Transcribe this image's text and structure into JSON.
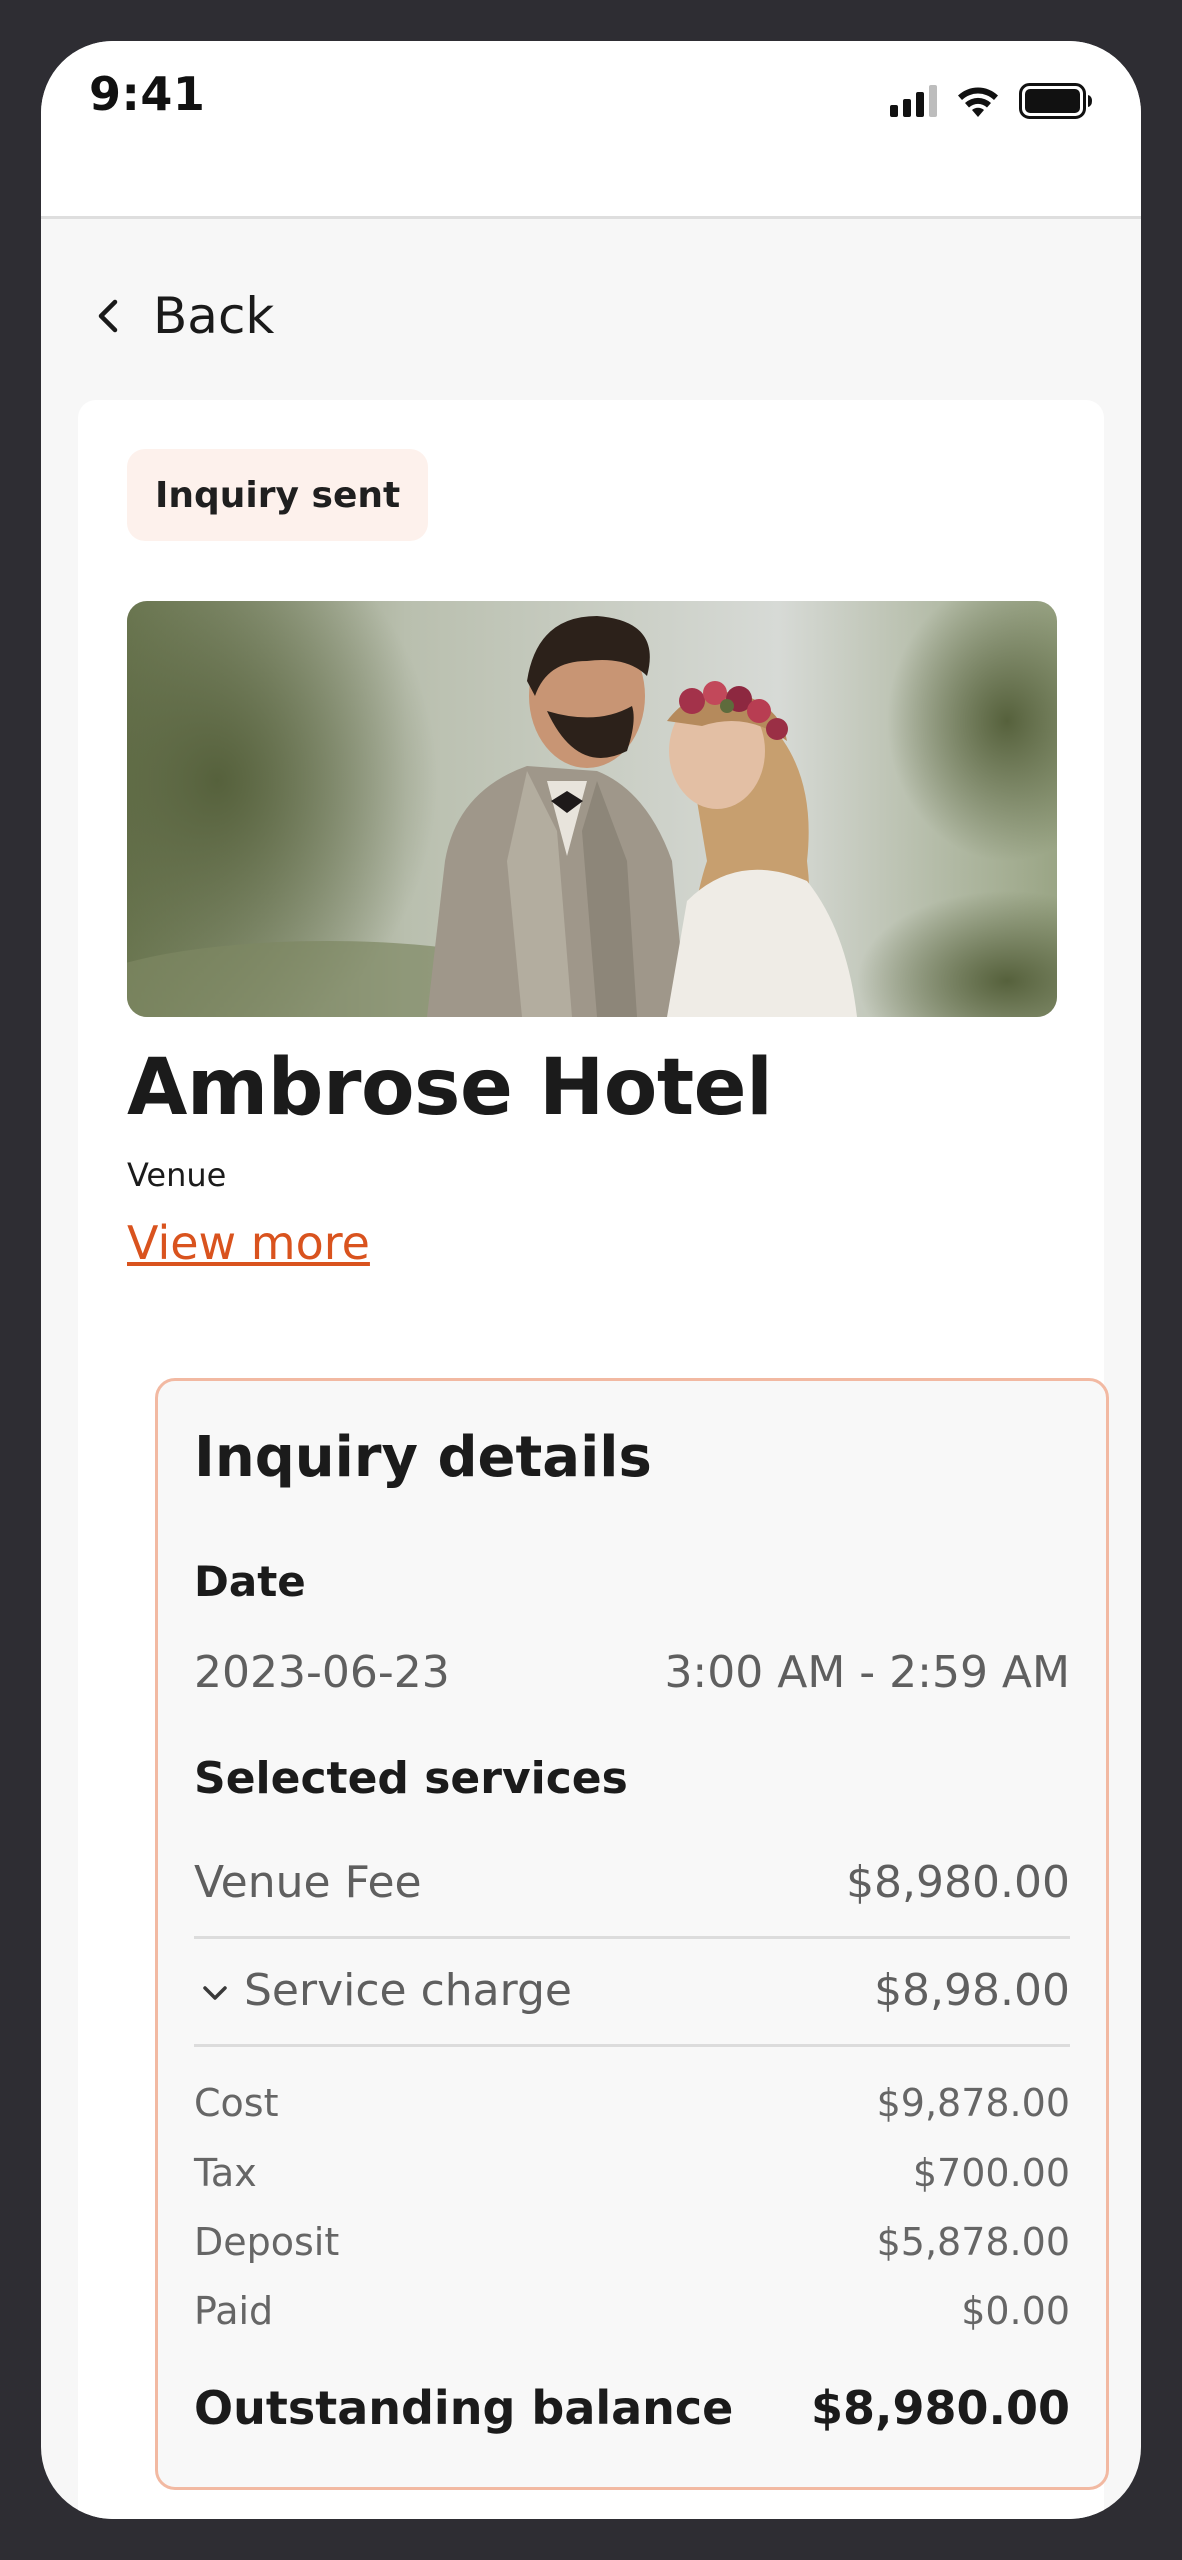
{
  "status_bar": {
    "time": "9:41",
    "signal_icon": "cellular-signal-icon",
    "wifi_icon": "wifi-icon",
    "battery_icon": "battery-icon"
  },
  "nav": {
    "back_label": "Back",
    "back_icon": "chevron-left-icon"
  },
  "listing": {
    "status_badge": "Inquiry sent",
    "name": "Ambrose Hotel",
    "category": "Venue",
    "view_more": "View more"
  },
  "inquiry": {
    "title": "Inquiry details",
    "date_label": "Date",
    "date": "2023-06-23",
    "time_range": "3:00 AM - 2:59 AM",
    "services_label": "Selected services",
    "services": [
      {
        "label": "Venue Fee",
        "amount": "$8,980.00"
      },
      {
        "label": "Service charge",
        "amount": "$8,98.00",
        "expand_icon": "chevron-down-icon"
      }
    ],
    "summary": [
      {
        "label": "Cost",
        "amount": "$9,878.00"
      },
      {
        "label": "Tax",
        "amount": "$700.00"
      },
      {
        "label": "Deposit",
        "amount": "$5,878.00"
      },
      {
        "label": "Paid",
        "amount": "$0.00"
      }
    ],
    "outstanding_label": "Outstanding balance",
    "outstanding_amount": "$8,980.00"
  },
  "colors": {
    "accent": "#d9531e",
    "badge_bg": "#fdf1ec",
    "details_border": "#f2b9a2",
    "frame": "#2e2d33"
  }
}
